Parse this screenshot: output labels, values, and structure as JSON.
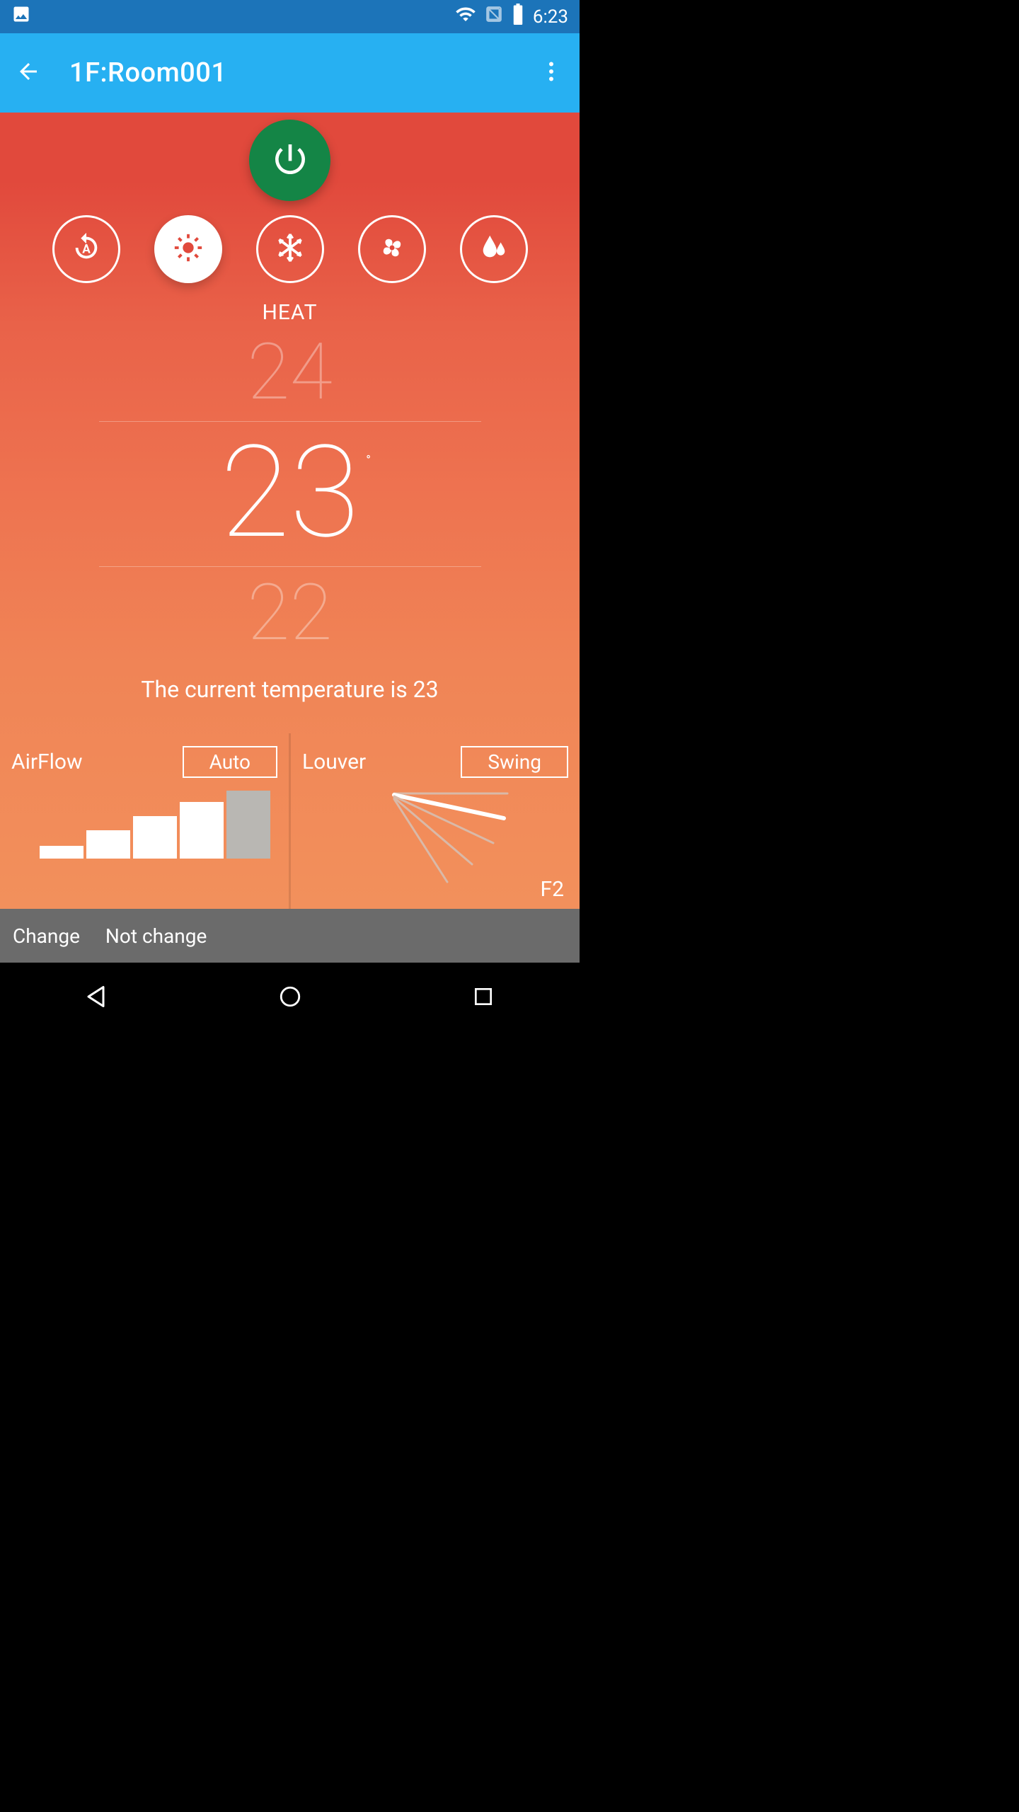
{
  "status": {
    "time": "6:23"
  },
  "appbar": {
    "title": "1F:Room001"
  },
  "mode": {
    "label": "HEAT"
  },
  "temp": {
    "above": "24",
    "current": "23",
    "below": "22",
    "degree": "°",
    "status": "The current temperature is 23"
  },
  "airflow": {
    "title": "AirFlow",
    "badge": "Auto"
  },
  "louver": {
    "title": "Louver",
    "badge": "Swing",
    "position": "F2"
  },
  "bottombar": {
    "change": "Change",
    "notchange": "Not change"
  },
  "colors": {
    "power_bg": "#148546",
    "appbar": "#27b0f2",
    "statusbar": "#1c74b9"
  }
}
